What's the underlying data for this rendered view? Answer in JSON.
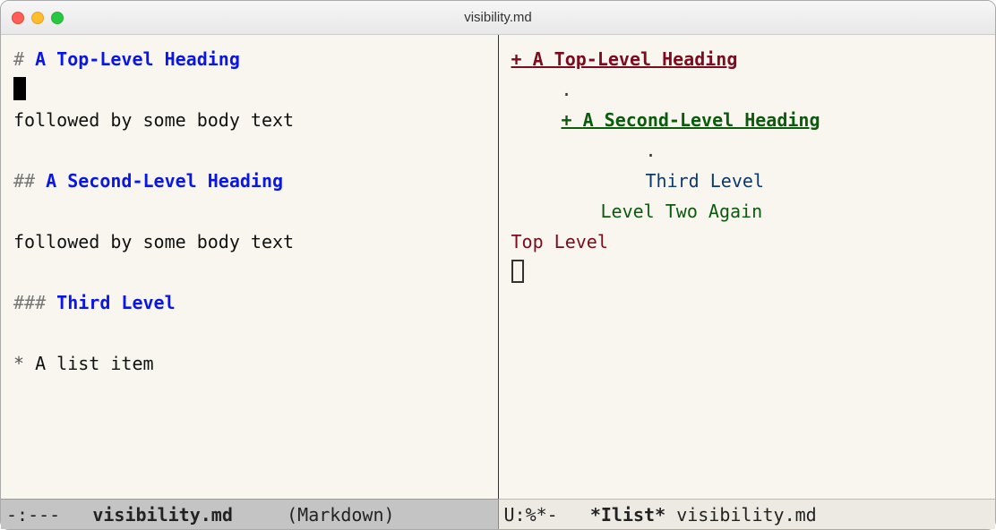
{
  "window": {
    "title": "visibility.md"
  },
  "left_pane": {
    "h1_prefix": "#",
    "h1_text": "A Top-Level Heading",
    "body1": "followed by some body text",
    "h2_prefix": "##",
    "h2_text": "A Second-Level Heading",
    "body2": "followed by some body text",
    "h3_prefix": "###",
    "h3_text": "Third Level",
    "list_star": "*",
    "list_item": "A list item"
  },
  "right_pane": {
    "h1_plus": "+",
    "h1_text": "A Top-Level Heading",
    "dot1": ".",
    "h2_plus": "+",
    "h2_text": "A Second-Level Heading",
    "dot2": ".",
    "h3_text": "Third Level",
    "h2_again": "Level Two Again",
    "h1_again": "Top Level"
  },
  "modeline_left": {
    "status": "-:--- ",
    "buffer": "visibility.md",
    "mode": "(Markdown)"
  },
  "modeline_right": {
    "status": "U:%*- ",
    "buffer": "*Ilist*",
    "file": "visibility.md"
  }
}
